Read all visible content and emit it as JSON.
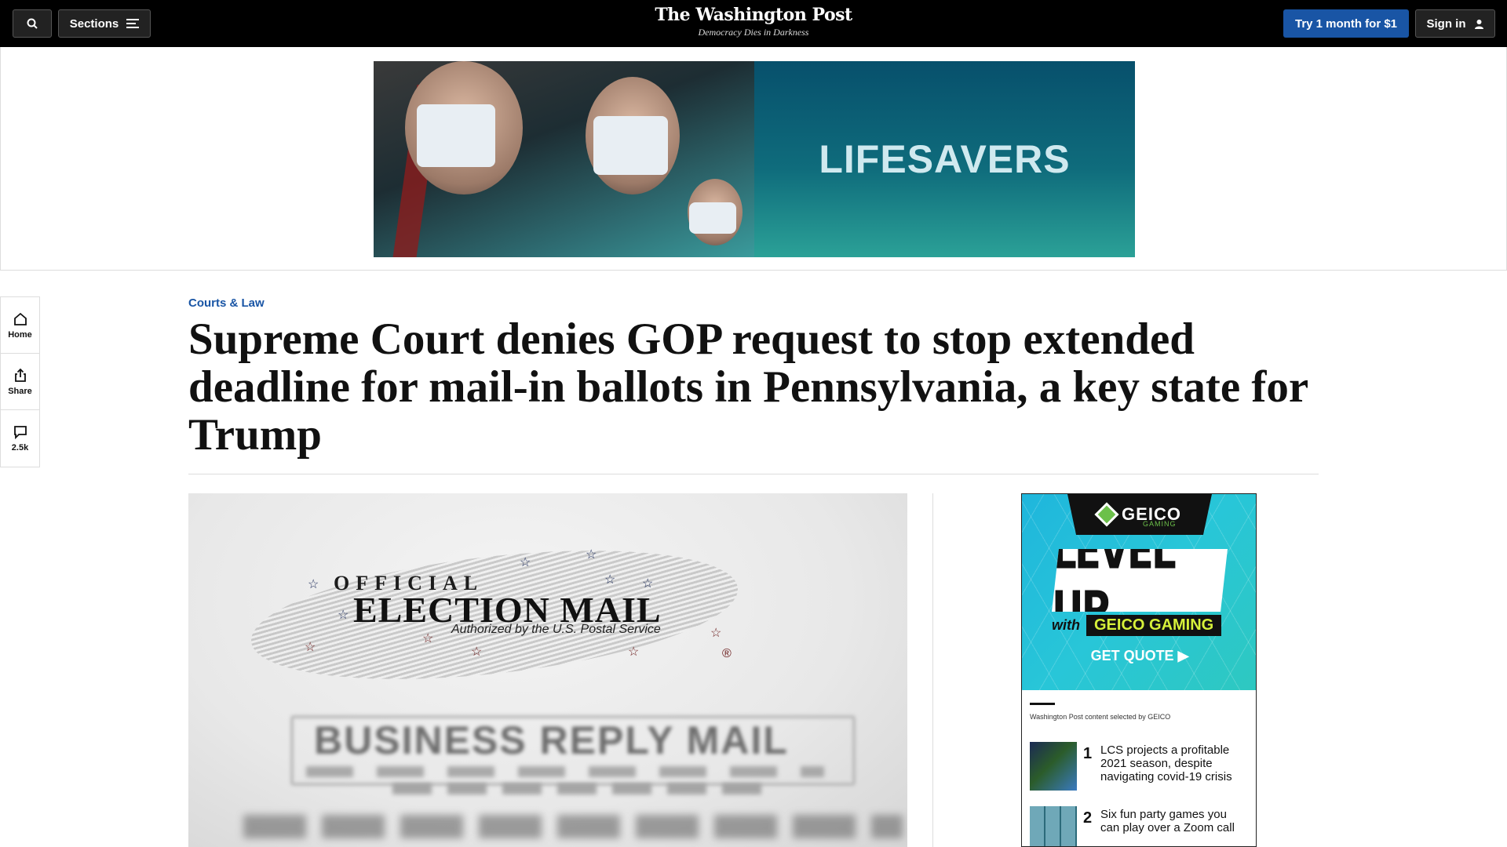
{
  "nav": {
    "search_icon": "search-icon",
    "sections_label": "Sections",
    "logo": "The Washington Post",
    "tagline": "Democracy Dies in Darkness",
    "subscribe_label": "Try 1 month for $1",
    "signin_label": "Sign in"
  },
  "top_ad": {
    "headline": "LIFESAVERS"
  },
  "left_rail": {
    "home_label": "Home",
    "share_label": "Share",
    "comments_label": "2.5k"
  },
  "article": {
    "kicker": "Courts & Law",
    "headline": "Supreme Court denies GOP request to stop extended deadline for mail-in ballots in Pennsylvania, a key state for Trump"
  },
  "lead_image": {
    "official": "OFFICIAL",
    "election_mail": "ELECTION MAIL",
    "authorized": "Authorized by the U.S. Postal Service",
    "business_reply": "BUSINESS REPLY MAIL"
  },
  "side_ad": {
    "brand": "GEICO",
    "brand_sub": "GAMING",
    "level_up": "LEVEL UP",
    "with": "with",
    "geico_gaming": "GEICO GAMING",
    "cta": "GET QUOTE ▶",
    "sponsored": "Washington Post content selected by GEICO",
    "promos": [
      {
        "num": "1",
        "text": "LCS projects a profitable 2021 season, despite navigating covid-19 crisis"
      },
      {
        "num": "2",
        "text": "Six fun party games you can play over a Zoom call"
      }
    ]
  },
  "colors": {
    "nav_bg": "#000000",
    "accent_blue": "#1955a5",
    "kicker_blue": "#1955a5"
  }
}
